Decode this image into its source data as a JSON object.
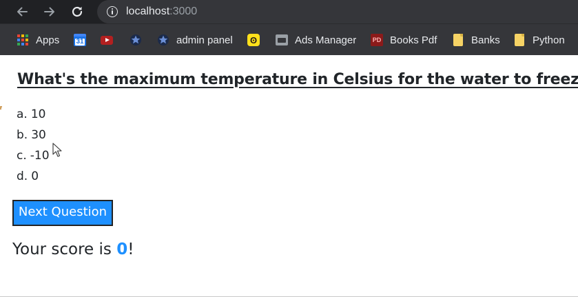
{
  "browser": {
    "url_host": "localhost",
    "url_port": ":3000",
    "bookmarks": [
      {
        "label": "Apps",
        "icon": "apps-grid-icon"
      },
      {
        "label": "",
        "icon": "google-calendar-icon",
        "badge": "31"
      },
      {
        "label": "",
        "icon": "youtube-icon"
      },
      {
        "label": "",
        "icon": "starred-site-icon"
      },
      {
        "label": "admin panel",
        "icon": "starred-site-icon"
      },
      {
        "label": "Ads Manager",
        "icon": "ads-manager-icon"
      },
      {
        "label": "Books Pdf",
        "icon": "pdf-icon"
      },
      {
        "label": "Banks",
        "icon": "folder-icon"
      },
      {
        "label": "Python",
        "icon": "folder-icon"
      }
    ]
  },
  "quiz": {
    "question": "What's the maximum temperature in Celsius for the water to freeze?",
    "options": [
      {
        "letter": "a.",
        "text": "10"
      },
      {
        "letter": "b.",
        "text": "30"
      },
      {
        "letter": "c.",
        "text": "-10"
      },
      {
        "letter": "d.",
        "text": "0"
      }
    ],
    "next_button_label": "Next Question",
    "score_prefix": "Your score is ",
    "score_value": "0",
    "score_suffix": "!"
  },
  "colors": {
    "accent": "#1e90ff",
    "text": "#212529",
    "chrome_dark": "#202124",
    "chrome_bar": "#35363a"
  }
}
